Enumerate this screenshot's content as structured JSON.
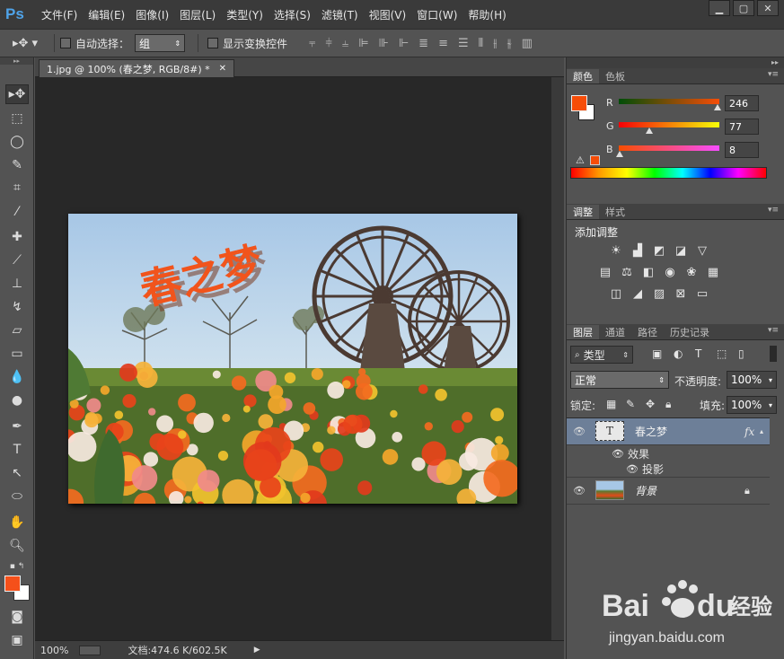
{
  "app": {
    "logo": "Ps"
  },
  "menu": [
    "文件(F)",
    "编辑(E)",
    "图像(I)",
    "图层(L)",
    "类型(Y)",
    "选择(S)",
    "滤镜(T)",
    "视图(V)",
    "窗口(W)",
    "帮助(H)"
  ],
  "options": {
    "auto_select_label": "自动选择：",
    "auto_select_value": "组",
    "show_transform_label": "显示变换控件"
  },
  "document": {
    "tab_title": "1.jpg @ 100% (春之梦, RGB/8#) *",
    "canvas_text": "春之梦",
    "status_zoom": "100%",
    "status_doc": "文档:474.6 K/602.5K"
  },
  "color_panel": {
    "tabs": [
      "颜色",
      "色板"
    ],
    "r_label": "R",
    "g_label": "G",
    "b_label": "B",
    "r": "246",
    "g": "77",
    "b": "8",
    "fg_color": "#f64d08"
  },
  "adjust_panel": {
    "tabs": [
      "调整",
      "样式"
    ],
    "title": "添加调整"
  },
  "layers_panel": {
    "tabs": [
      "图层",
      "通道",
      "路径",
      "历史记录"
    ],
    "filter_label": "类型",
    "blend_mode": "正常",
    "opacity_label": "不透明度:",
    "opacity_value": "100%",
    "lock_label": "锁定:",
    "fill_label": "填充:",
    "fill_value": "100%",
    "layers": [
      {
        "name": "春之梦",
        "type": "text",
        "fx": "fx"
      },
      {
        "name": "效果"
      },
      {
        "name": "投影"
      },
      {
        "name": "背景",
        "type": "image"
      }
    ]
  },
  "watermark": {
    "brand": "Bai",
    "brand2": "du",
    "cn": "经验",
    "url": "jingyan.baidu.com"
  }
}
